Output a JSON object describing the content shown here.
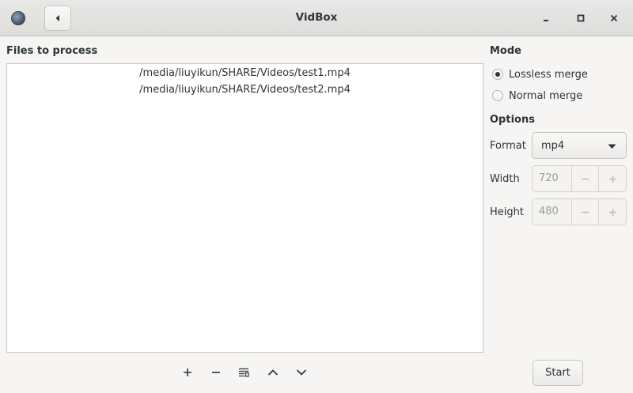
{
  "window": {
    "title": "VidBox"
  },
  "files": {
    "heading": "Files to process",
    "items": [
      "/media/liuyikun/SHARE/Videos/test1.mp4",
      "/media/liuyikun/SHARE/Videos/test2.mp4"
    ]
  },
  "toolbar": {
    "icons": [
      "add-icon",
      "remove-icon",
      "properties-icon",
      "move-up-icon",
      "move-down-icon"
    ]
  },
  "mode": {
    "heading": "Mode",
    "options": [
      {
        "label": "Lossless merge",
        "checked": true
      },
      {
        "label": "Normal merge",
        "checked": false
      }
    ]
  },
  "options": {
    "heading": "Options",
    "format": {
      "label": "Format",
      "value": "mp4"
    },
    "width": {
      "label": "Width",
      "value": "720"
    },
    "height": {
      "label": "Height",
      "value": "480"
    }
  },
  "actions": {
    "start_label": "Start"
  }
}
